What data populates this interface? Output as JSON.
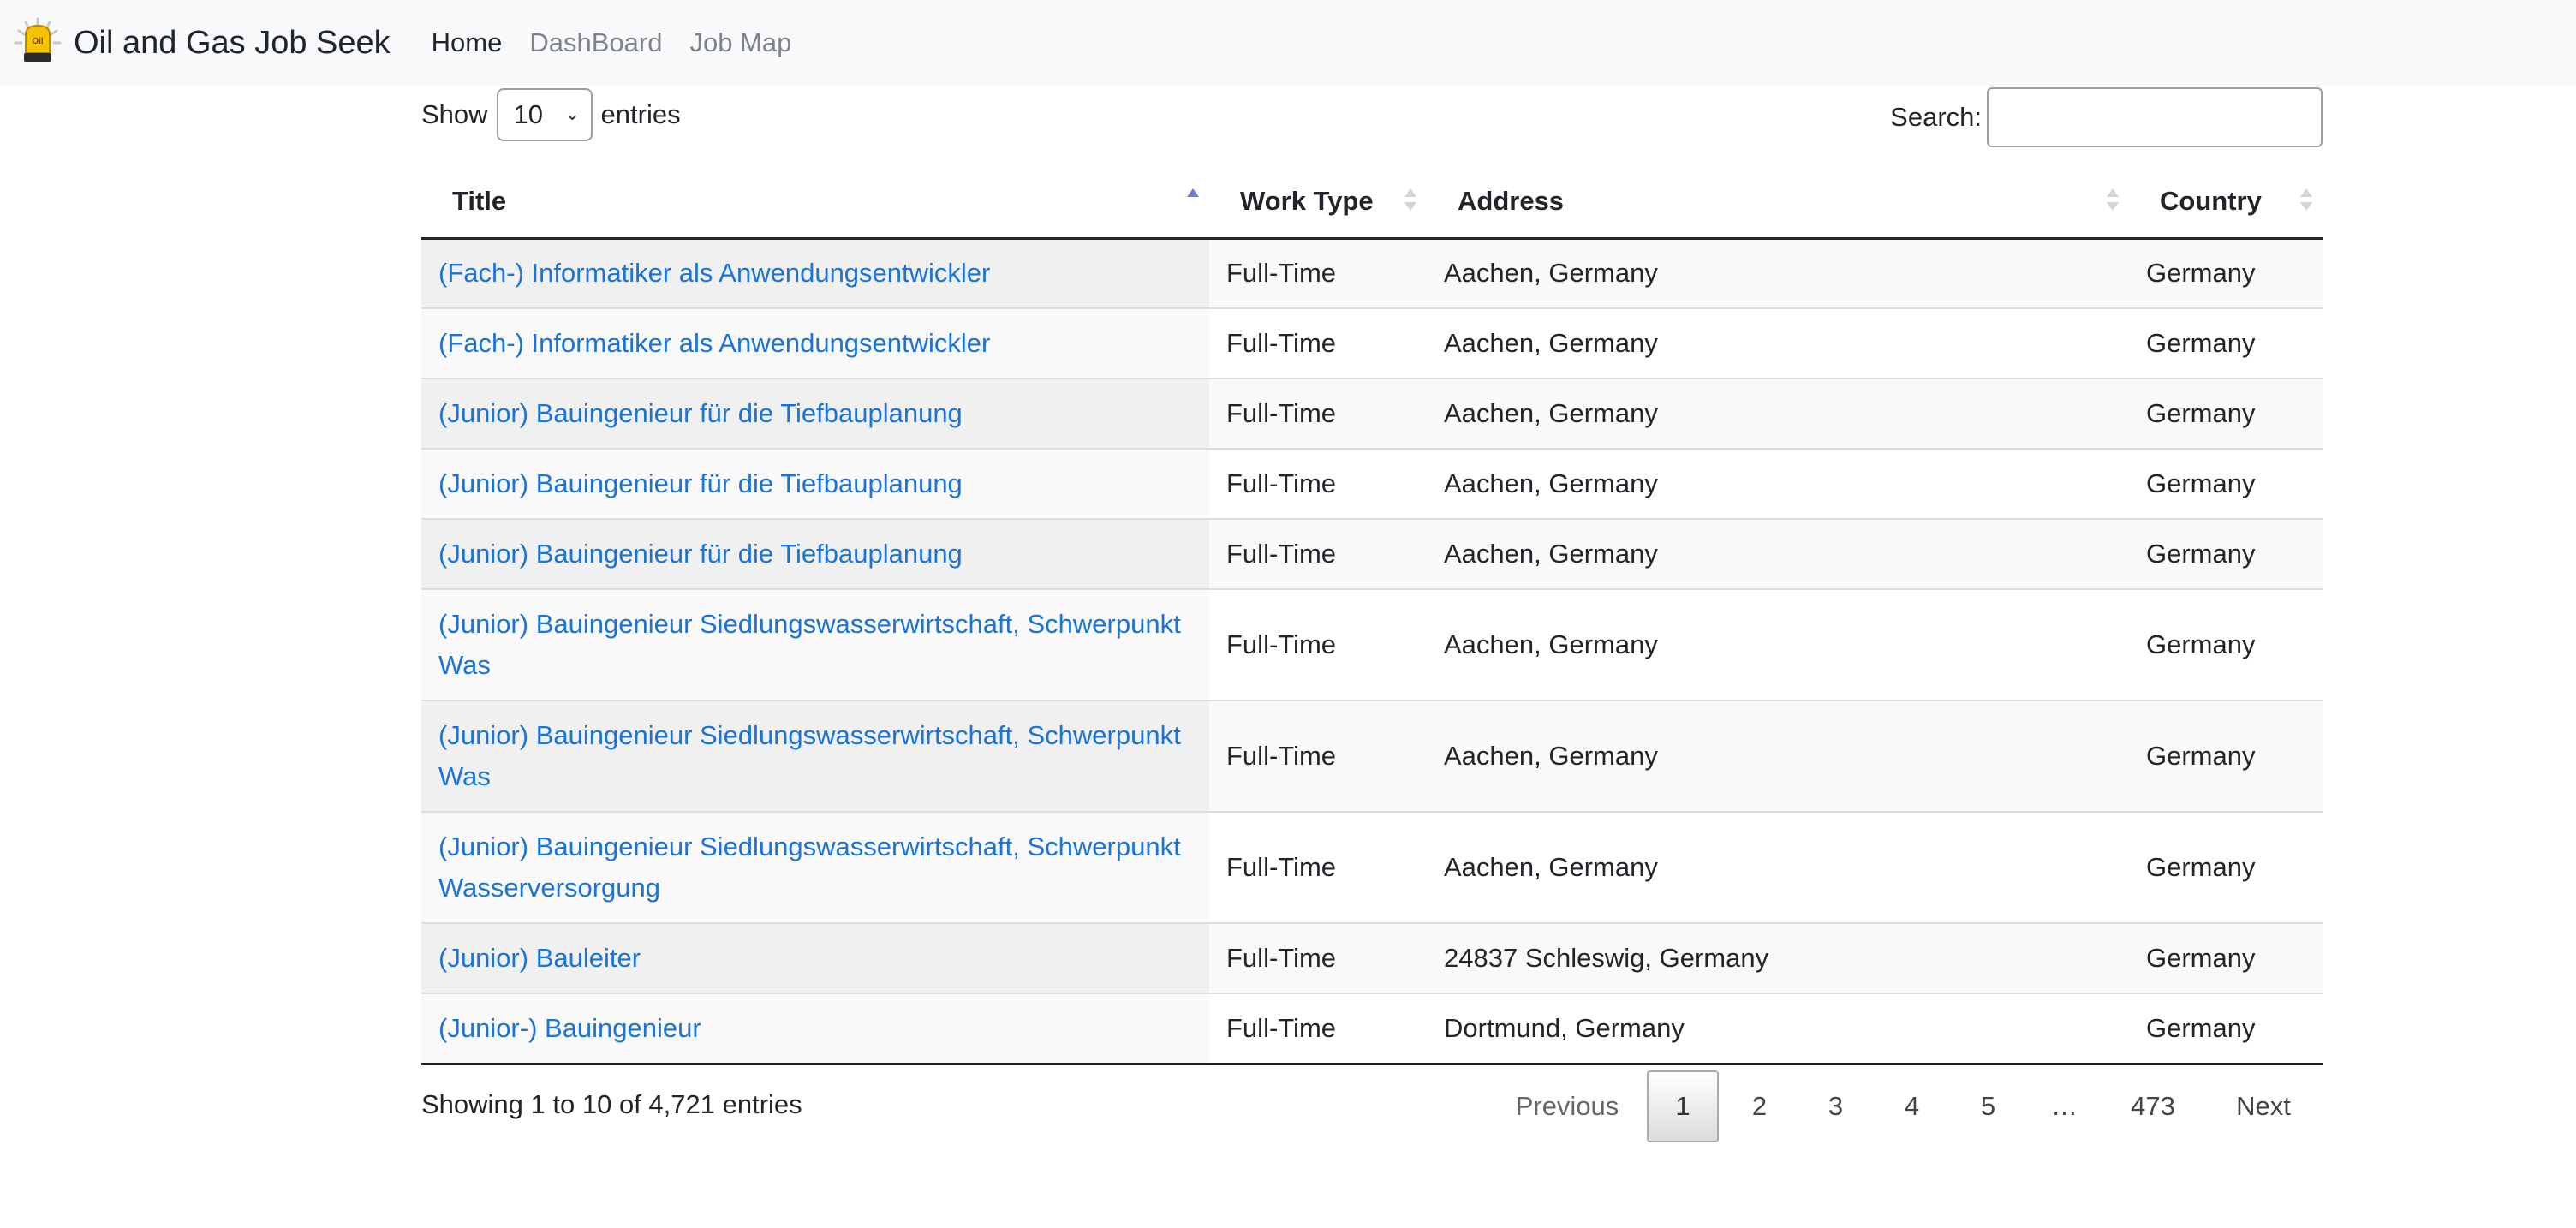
{
  "nav": {
    "brand": "Oil and Gas Job Seek",
    "logo_text": "Oil",
    "links": [
      "Home",
      "DashBoard",
      "Job Map"
    ]
  },
  "controls": {
    "show_label": "Show",
    "entries_value": "10",
    "entries_label": "entries",
    "search_label": "Search:",
    "search_value": ""
  },
  "table": {
    "headers": [
      "Title",
      "Work Type",
      "Address",
      "Country"
    ],
    "rows": [
      {
        "title": "(Fach-) Informatiker als Anwendungsentwickler",
        "work_type": "Full-Time",
        "address": "Aachen, Germany",
        "country": "Germany"
      },
      {
        "title": "(Fach-) Informatiker als Anwendungsentwickler",
        "work_type": "Full-Time",
        "address": "Aachen, Germany",
        "country": "Germany"
      },
      {
        "title": "(Junior) Bauingenieur für die Tiefbauplanung",
        "work_type": "Full-Time",
        "address": "Aachen, Germany",
        "country": "Germany"
      },
      {
        "title": "(Junior) Bauingenieur für die Tiefbauplanung",
        "work_type": "Full-Time",
        "address": "Aachen, Germany",
        "country": "Germany"
      },
      {
        "title": "(Junior) Bauingenieur für die Tiefbauplanung",
        "work_type": "Full-Time",
        "address": "Aachen, Germany",
        "country": "Germany"
      },
      {
        "title": "(Junior) Bauingenieur Siedlungswasserwirtschaft, Schwerpunkt Was",
        "work_type": "Full-Time",
        "address": "Aachen, Germany",
        "country": "Germany"
      },
      {
        "title": "(Junior) Bauingenieur Siedlungswasserwirtschaft, Schwerpunkt Was",
        "work_type": "Full-Time",
        "address": "Aachen, Germany",
        "country": "Germany"
      },
      {
        "title": "(Junior) Bauingenieur Siedlungswasserwirtschaft, Schwerpunkt Wasserversorgung",
        "work_type": "Full-Time",
        "address": "Aachen, Germany",
        "country": "Germany"
      },
      {
        "title": "(Junior) Bauleiter",
        "work_type": "Full-Time",
        "address": "24837 Schleswig, Germany",
        "country": "Germany"
      },
      {
        "title": "(Junior-) Bauingenieur",
        "work_type": "Full-Time",
        "address": "Dortmund, Germany",
        "country": "Germany"
      }
    ]
  },
  "footer": {
    "info": "Showing 1 to 10 of 4,721 entries",
    "previous": "Previous",
    "pages": [
      "1",
      "2",
      "3",
      "4",
      "5"
    ],
    "ellipsis": "…",
    "last_page": "473",
    "next": "Next"
  },
  "colors": {
    "navbar_bg": "#f8f9fa",
    "link": "#1a73d9",
    "sort_active": "#6f7bd4"
  }
}
